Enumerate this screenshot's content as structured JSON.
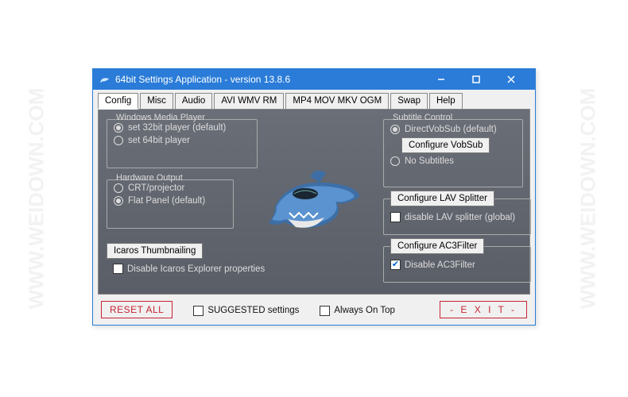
{
  "watermark": "WWW.WEIDOWN.COM",
  "window": {
    "title": "64bit Settings Application - version 13.8.6"
  },
  "tabs": [
    "Config",
    "Misc",
    "Audio",
    "AVI WMV RM",
    "MP4 MOV MKV OGM",
    "Swap",
    "Help"
  ],
  "wmp": {
    "title": "Windows Media Player",
    "opt1": "set 32bit player (default)",
    "opt2": "set 64bit player"
  },
  "hw": {
    "title": "Hardware Output",
    "opt1": "CRT/projector",
    "opt2": "Flat Panel (default)"
  },
  "icaros": {
    "button": "Icaros Thumbnailing",
    "check": "Disable Icaros Explorer properties"
  },
  "sub": {
    "title": "Subtitle Control",
    "opt1": "DirectVobSub (default)",
    "btn": "Configure VobSub",
    "opt2": "No Subtitles"
  },
  "lav": {
    "btn": "Configure LAV Splitter",
    "check": "disable LAV splitter (global)"
  },
  "ac3": {
    "btn": "Configure AC3Filter",
    "check": "Disable AC3Filter"
  },
  "bottom": {
    "reset": "RESET ALL",
    "suggested": "SUGGESTED settings",
    "ontop": "Always On Top",
    "exit": "- E X I T -"
  }
}
